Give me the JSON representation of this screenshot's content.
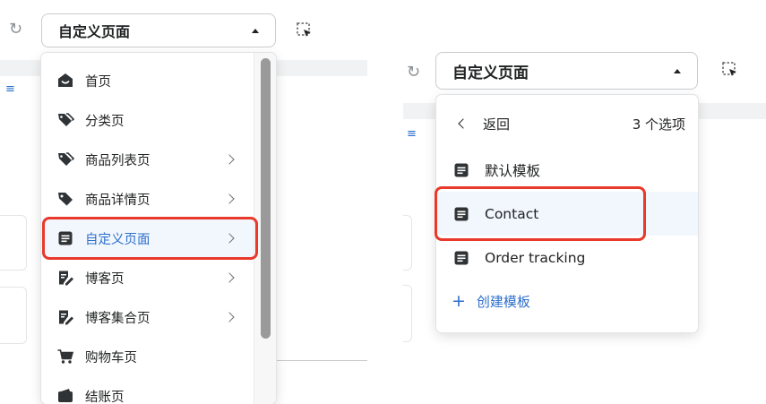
{
  "left": {
    "page_selector": {
      "value": "自定义页面"
    },
    "menu": [
      {
        "label": "首页",
        "icon": "home-icon",
        "has_submenu": false
      },
      {
        "label": "分类页",
        "icon": "tags-icon",
        "has_submenu": false
      },
      {
        "label": "商品列表页",
        "icon": "tags-icon",
        "has_submenu": true
      },
      {
        "label": "商品详情页",
        "icon": "tag-icon",
        "has_submenu": true
      },
      {
        "label": "自定义页面",
        "icon": "page-icon",
        "has_submenu": true,
        "selected": true
      },
      {
        "label": "博客页",
        "icon": "blog-edit-icon",
        "has_submenu": true
      },
      {
        "label": "博客集合页",
        "icon": "blog-edit-icon",
        "has_submenu": true
      },
      {
        "label": "购物车页",
        "icon": "cart-icon",
        "has_submenu": false
      },
      {
        "label": "结账页",
        "icon": "checkout-icon",
        "has_submenu": false
      }
    ]
  },
  "right": {
    "page_selector": {
      "value": "自定义页面"
    },
    "back_label": "返回",
    "option_count": "3 个选项",
    "templates": [
      {
        "label": "默认模板",
        "icon": "page-icon"
      },
      {
        "label": "Contact",
        "icon": "page-icon",
        "selected": true
      },
      {
        "label": "Order tracking",
        "icon": "page-icon"
      }
    ],
    "create_label": "创建模板"
  },
  "colors": {
    "accent": "#2c6ecb",
    "highlight": "#e8392b",
    "selected_bg": "#f2f7fe"
  }
}
